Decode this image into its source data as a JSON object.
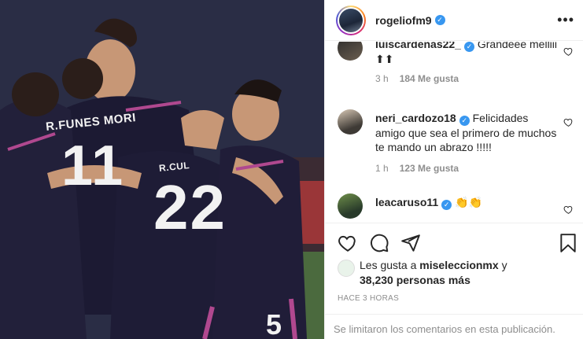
{
  "post": {
    "username": "rogeliofm9",
    "more_label": "•••",
    "photo_texts": {
      "player_name": "R.FUNES MORI",
      "player_number": "11",
      "player2_name": "R.CUL",
      "player2_number": "22",
      "player3_number": "5"
    }
  },
  "comments": [
    {
      "user": "luiscardenas22_",
      "text": "Grandeee melliii ⬆⬆",
      "time": "3 h",
      "likes": "184 Me gusta",
      "verified": true
    },
    {
      "user": "neri_cardozo18",
      "text": "Felicidades amigo que sea el primero de muchos te mando un abrazo !!!!!",
      "time": "1 h",
      "likes": "123 Me gusta",
      "verified": true
    },
    {
      "user": "leacaruso11",
      "text": "👏👏",
      "verified": true
    }
  ],
  "likes": {
    "prefix": "Les gusta a",
    "first_user": "miseleccionmx",
    "connector": "y",
    "others": "38,230 personas más"
  },
  "timestamp": "HACE 3 HORAS",
  "footer": "Se limitaron los comentarios en esta publicación.",
  "icons": {
    "heart": "heart-icon",
    "comment": "comment-icon",
    "share": "share-icon",
    "save": "bookmark-icon"
  }
}
